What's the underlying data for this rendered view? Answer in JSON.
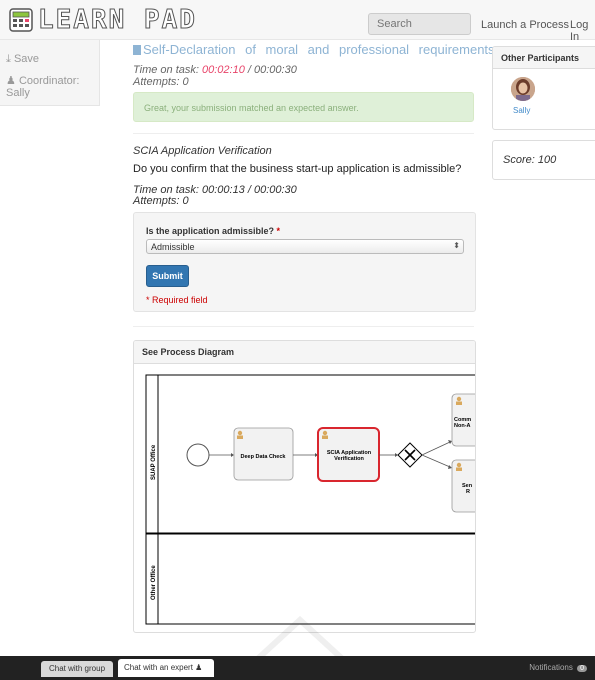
{
  "header": {
    "logo_text": "LEARN PAD",
    "search_placeholder": "Search",
    "launch_label": "Launch a Process",
    "login_label": "Log In"
  },
  "sidebar": {
    "save_label": "Save",
    "coordinator_label": "Coordinator:",
    "coordinator_name": "Sally"
  },
  "previous_task": {
    "title": "Self-Declaration of moral and professional requirements",
    "time_label": "Time on task:",
    "time_spent": "00:02:10",
    "time_limit": "/ 00:00:30",
    "attempts": "Attempts: 0",
    "success_message": "Great, your submission matched an expected answer."
  },
  "current_task": {
    "subtitle": "SCIA Application Verification",
    "question": "Do you confirm that the business start-up application is admissible?",
    "time_text": "Time on task: 00:00:13 / 00:00:30",
    "attempts": "Attempts: 0",
    "field_label": "Is the application admissible?",
    "required_marker": "*",
    "selected_option": "Admissible",
    "submit_label": "Submit",
    "required_note": "* Required field"
  },
  "diagram": {
    "panel_title": "See Process Diagram",
    "lane_top": "SUAP Office",
    "lane_bottom": "Other Office",
    "task_1": "Deep Data Check",
    "task_2_line1": "SCIA Application",
    "task_2_line2": "Verification",
    "task_3_line1": "Comm",
    "task_3_line2": "Non-A",
    "task_4_line1": "Sen",
    "task_4_line2": "R",
    "highlight_color": "#d9262e"
  },
  "participants": {
    "title": "Other Participants",
    "name": "Sally"
  },
  "score": {
    "text": "Score: 100"
  },
  "bottom": {
    "chat_group": "Chat with group",
    "chat_expert": "Chat with an expert",
    "notifications_label": "Notifications",
    "notifications_count": "0"
  }
}
